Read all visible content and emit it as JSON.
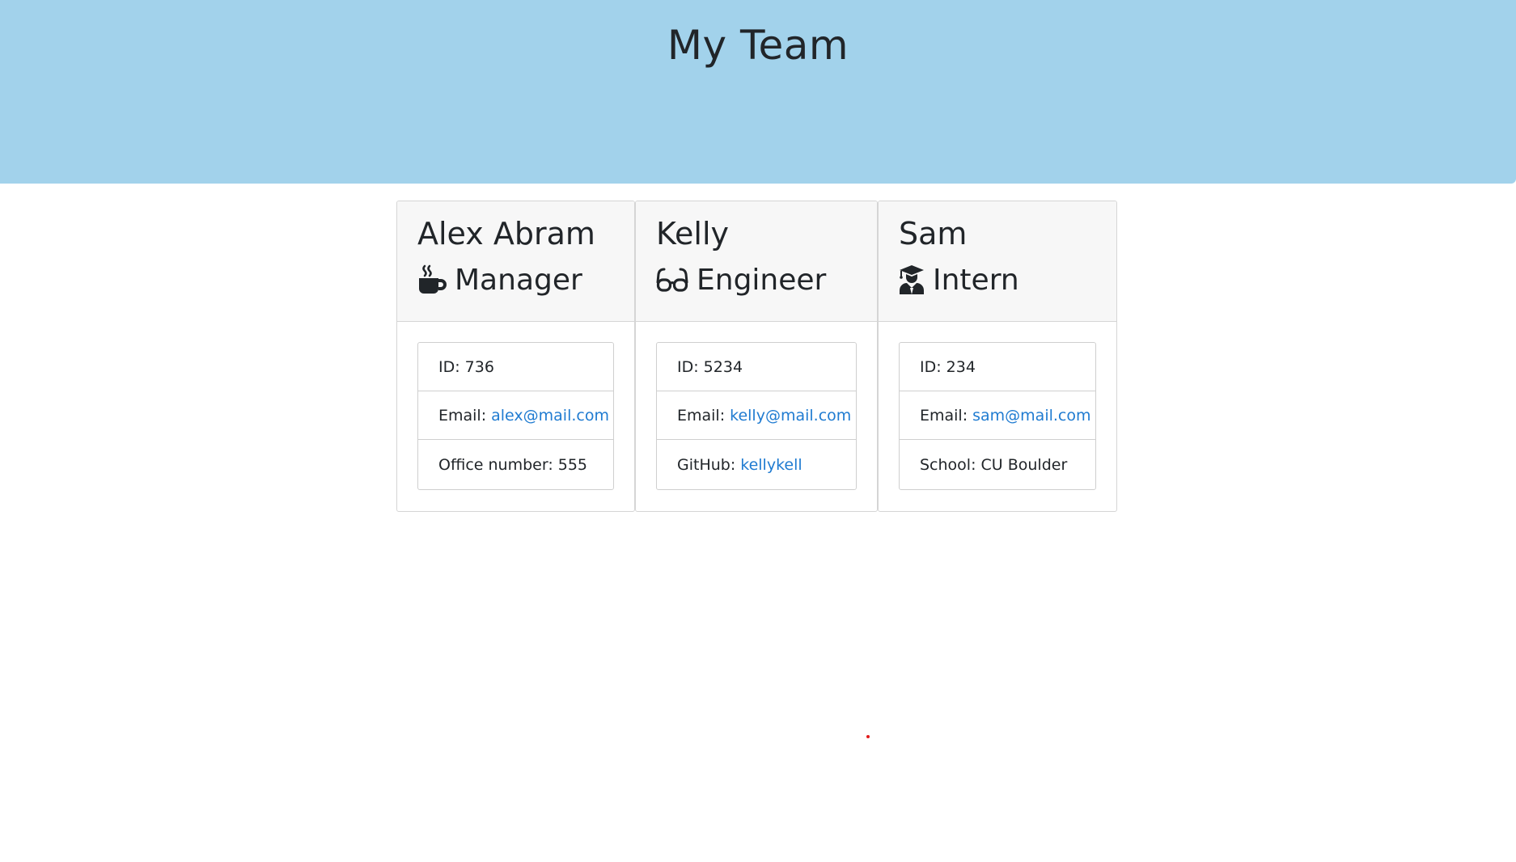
{
  "header": {
    "title": "My Team",
    "background": "#a2d2eb"
  },
  "cards": [
    {
      "name": "Alex Abram",
      "role": "Manager",
      "role_icon": "mug-hot-icon",
      "id_label": "ID: 736",
      "email_label": "Email:",
      "email": "alex@mail.com",
      "extra_label": "Office number: 555",
      "extra_link": ""
    },
    {
      "name": "Kelly",
      "role": "Engineer",
      "role_icon": "glasses-icon",
      "id_label": "ID: 5234",
      "email_label": "Email:",
      "email": "kelly@mail.com",
      "extra_label": "GitHub:",
      "extra_link": "kellykell"
    },
    {
      "name": "Sam",
      "role": "Intern",
      "role_icon": "user-graduate-icon",
      "id_label": "ID: 234",
      "email_label": "Email:",
      "email": "sam@mail.com",
      "extra_label": "School: CU Boulder",
      "extra_link": ""
    }
  ],
  "colors": {
    "link": "#1f7bd1",
    "card_header": "#f7f7f7",
    "text": "#212529"
  }
}
